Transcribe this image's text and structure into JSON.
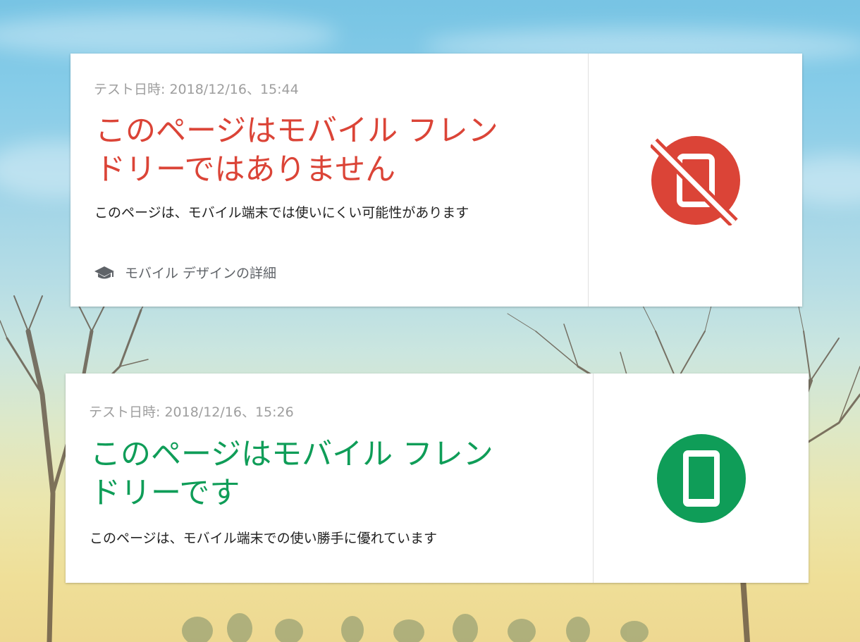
{
  "colors": {
    "fail_red": "#db4437",
    "pass_green": "#0f9d58"
  },
  "results": [
    {
      "test_date": "テスト日時: 2018/12/16、15:44",
      "headline_line1": "このページはモバイル フレン",
      "headline_line2": "ドリーではありません",
      "description": "このページは、モバイル端末では使いにくい可能性があります",
      "learn_more": "モバイル デザインの詳細",
      "learn_more_icon": "graduation-cap-icon",
      "status_icon": "mobile-off-icon"
    },
    {
      "test_date": "テスト日時: 2018/12/16、15:26",
      "headline_line1": "このページはモバイル フレン",
      "headline_line2": "ドリーです",
      "description": "このページは、モバイル端末での使い勝手に優れています",
      "status_icon": "mobile-friendly-icon"
    }
  ]
}
